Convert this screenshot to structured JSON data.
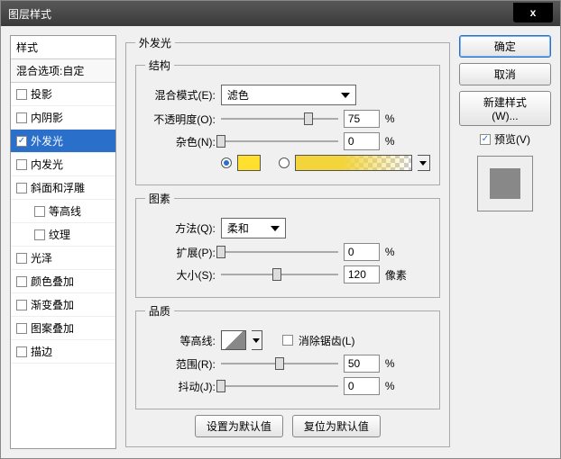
{
  "window": {
    "title": "图层样式",
    "close": "x"
  },
  "sidebar": {
    "header": "样式",
    "blend_opts": "混合选项:自定",
    "items": [
      {
        "label": "投影",
        "checked": false
      },
      {
        "label": "内阴影",
        "checked": false
      },
      {
        "label": "外发光",
        "checked": true,
        "selected": true
      },
      {
        "label": "内发光",
        "checked": false
      },
      {
        "label": "斜面和浮雕",
        "checked": false
      },
      {
        "label": "等高线",
        "checked": false,
        "indent": true
      },
      {
        "label": "纹理",
        "checked": false,
        "indent": true
      },
      {
        "label": "光泽",
        "checked": false
      },
      {
        "label": "颜色叠加",
        "checked": false
      },
      {
        "label": "渐变叠加",
        "checked": false
      },
      {
        "label": "图案叠加",
        "checked": false
      },
      {
        "label": "描边",
        "checked": false
      }
    ]
  },
  "main": {
    "title": "外发光",
    "structure": {
      "legend": "结构",
      "blend_mode_label": "混合模式(E):",
      "blend_mode_value": "滤色",
      "opacity_label": "不透明度(O):",
      "opacity_value": "75",
      "opacity_unit": "%",
      "noise_label": "杂色(N):",
      "noise_value": "0",
      "noise_unit": "%"
    },
    "elements": {
      "legend": "图素",
      "technique_label": "方法(Q):",
      "technique_value": "柔和",
      "spread_label": "扩展(P):",
      "spread_value": "0",
      "spread_unit": "%",
      "size_label": "大小(S):",
      "size_value": "120",
      "size_unit": "像素"
    },
    "quality": {
      "legend": "品质",
      "contour_label": "等高线:",
      "antialias_label": "消除锯齿(L)",
      "range_label": "范围(R):",
      "range_value": "50",
      "range_unit": "%",
      "jitter_label": "抖动(J):",
      "jitter_value": "0",
      "jitter_unit": "%"
    },
    "buttons": {
      "make_default": "设置为默认值",
      "reset_default": "复位为默认值"
    }
  },
  "right": {
    "ok": "确定",
    "cancel": "取消",
    "new_style": "新建样式(W)...",
    "preview_label": "预览(V)",
    "preview_checked": true
  }
}
